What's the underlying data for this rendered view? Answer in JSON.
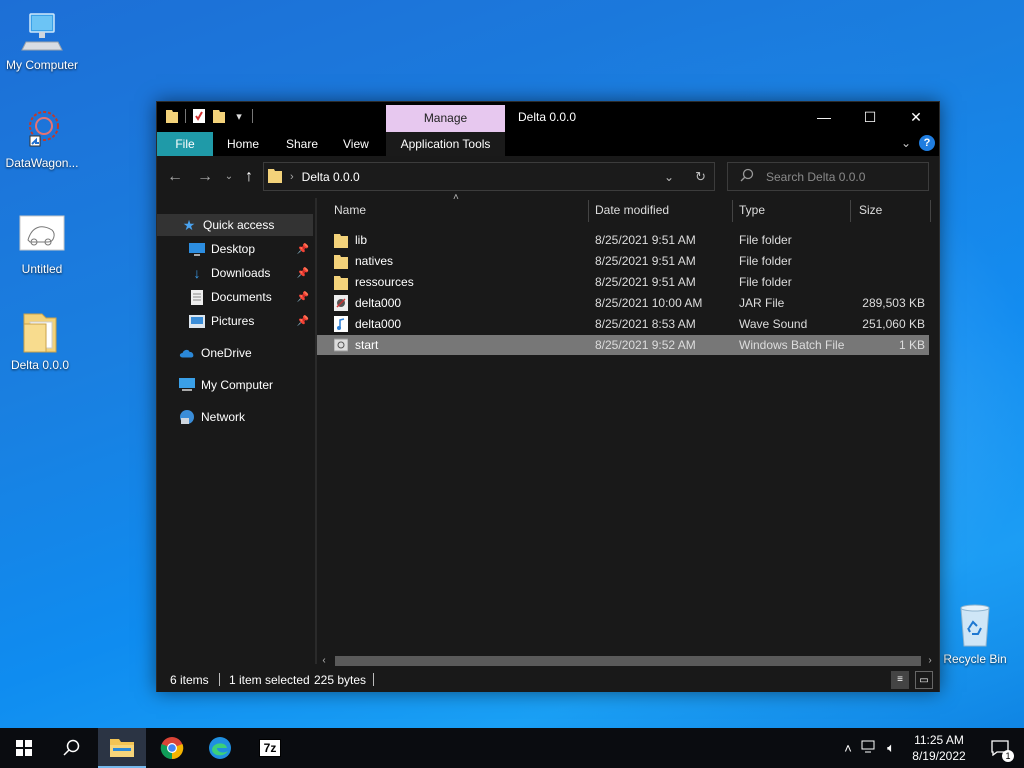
{
  "desktop": {
    "icons": [
      {
        "label": "My Computer"
      },
      {
        "label": "DataWagon..."
      },
      {
        "label": "Untitled"
      },
      {
        "label": "Delta 0.0.0"
      },
      {
        "label": "Recycle Bin"
      }
    ]
  },
  "window": {
    "title": "Delta 0.0.0",
    "manage_tab": "Manage",
    "ribbon_tabs": [
      "File",
      "Home",
      "Share",
      "View",
      "Application Tools"
    ],
    "controls": {
      "minimize": "—",
      "maximize": "☐",
      "close": "✕"
    },
    "address": {
      "path": "Delta 0.0.0"
    },
    "search": {
      "placeholder": "Search Delta 0.0.0"
    },
    "nav": {
      "quick_access": "Quick access",
      "items": [
        {
          "label": "Desktop",
          "pinned": true
        },
        {
          "label": "Downloads",
          "pinned": true
        },
        {
          "label": "Documents",
          "pinned": true
        },
        {
          "label": "Pictures",
          "pinned": true
        }
      ],
      "onedrive": "OneDrive",
      "my_computer": "My Computer",
      "network": "Network"
    },
    "columns": {
      "name": "Name",
      "date": "Date modified",
      "type": "Type",
      "size": "Size"
    },
    "files": [
      {
        "name": "lib",
        "date": "8/25/2021 9:51 AM",
        "type": "File folder",
        "size": "",
        "icon": "folder-icon"
      },
      {
        "name": "natives",
        "date": "8/25/2021 9:51 AM",
        "type": "File folder",
        "size": "",
        "icon": "folder-icon"
      },
      {
        "name": "ressources",
        "date": "8/25/2021 9:51 AM",
        "type": "File folder",
        "size": "",
        "icon": "folder-icon"
      },
      {
        "name": "delta000",
        "date": "8/25/2021 10:00 AM",
        "type": "JAR File",
        "size": "289,503 KB",
        "icon": "jar-file-icon"
      },
      {
        "name": "delta000",
        "date": "8/25/2021 8:53 AM",
        "type": "Wave Sound",
        "size": "251,060 KB",
        "icon": "audio-file-icon"
      },
      {
        "name": "start",
        "date": "8/25/2021 9:52 AM",
        "type": "Windows Batch File",
        "size": "1 KB",
        "icon": "batch-file-icon",
        "selected": true
      }
    ],
    "status": {
      "items": "6 items",
      "selected": "1 item selected",
      "bytes": "225 bytes"
    }
  },
  "taskbar": {
    "time": "11:25 AM",
    "date": "8/19/2022",
    "notifications": "1",
    "apps": [
      "7z"
    ]
  },
  "colors": {
    "accent_file_tab": "#1f9aa8",
    "manage_tab": "#e7c8ef",
    "selection": "#777777"
  }
}
